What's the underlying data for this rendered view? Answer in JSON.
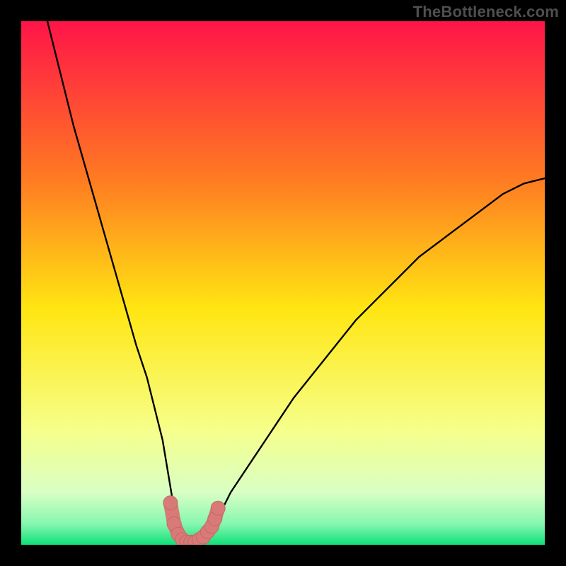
{
  "watermark": "TheBottleneck.com",
  "colors": {
    "frame": "#000000",
    "gradient_top": "#ff1448",
    "gradient_mid1": "#ff7a22",
    "gradient_mid2": "#ffe612",
    "gradient_mid3": "#f6ff8a",
    "gradient_low1": "#d9ffc4",
    "gradient_low2": "#86f7b0",
    "gradient_bottom": "#0fe07a",
    "curve": "#000000",
    "marker_fill": "#d77a78",
    "marker_stroke": "#c86865"
  },
  "chart_data": {
    "type": "line",
    "title": "",
    "xlabel": "",
    "ylabel": "",
    "xlim": [
      0,
      100
    ],
    "ylim": [
      0,
      100
    ],
    "series": [
      {
        "name": "bottleneck-curve",
        "x": [
          5,
          8,
          10,
          12,
          14,
          16,
          18,
          20,
          22,
          24,
          26,
          27,
          28,
          29,
          30,
          31,
          32,
          33,
          34,
          35,
          36,
          37,
          38,
          40,
          44,
          48,
          52,
          56,
          60,
          64,
          68,
          72,
          76,
          80,
          84,
          88,
          92,
          96,
          100
        ],
        "y": [
          100,
          88,
          80,
          73,
          66,
          59,
          52,
          45,
          38,
          32,
          24,
          20,
          14,
          8,
          3,
          1,
          0,
          0,
          1,
          2,
          3,
          4,
          6,
          10,
          16,
          22,
          28,
          33,
          38,
          43,
          47,
          51,
          55,
          58,
          61,
          64,
          67,
          69,
          70
        ]
      }
    ],
    "markers": {
      "name": "highlight-band",
      "x": [
        28.5,
        29.2,
        30,
        30.8,
        31.6,
        32.4,
        33.2,
        34,
        34.8,
        35.6,
        36.4,
        37,
        37.6
      ],
      "y": [
        8,
        4,
        2,
        1,
        0.5,
        0.5,
        0.5,
        1,
        1.5,
        2.5,
        3.5,
        5,
        7
      ]
    }
  }
}
